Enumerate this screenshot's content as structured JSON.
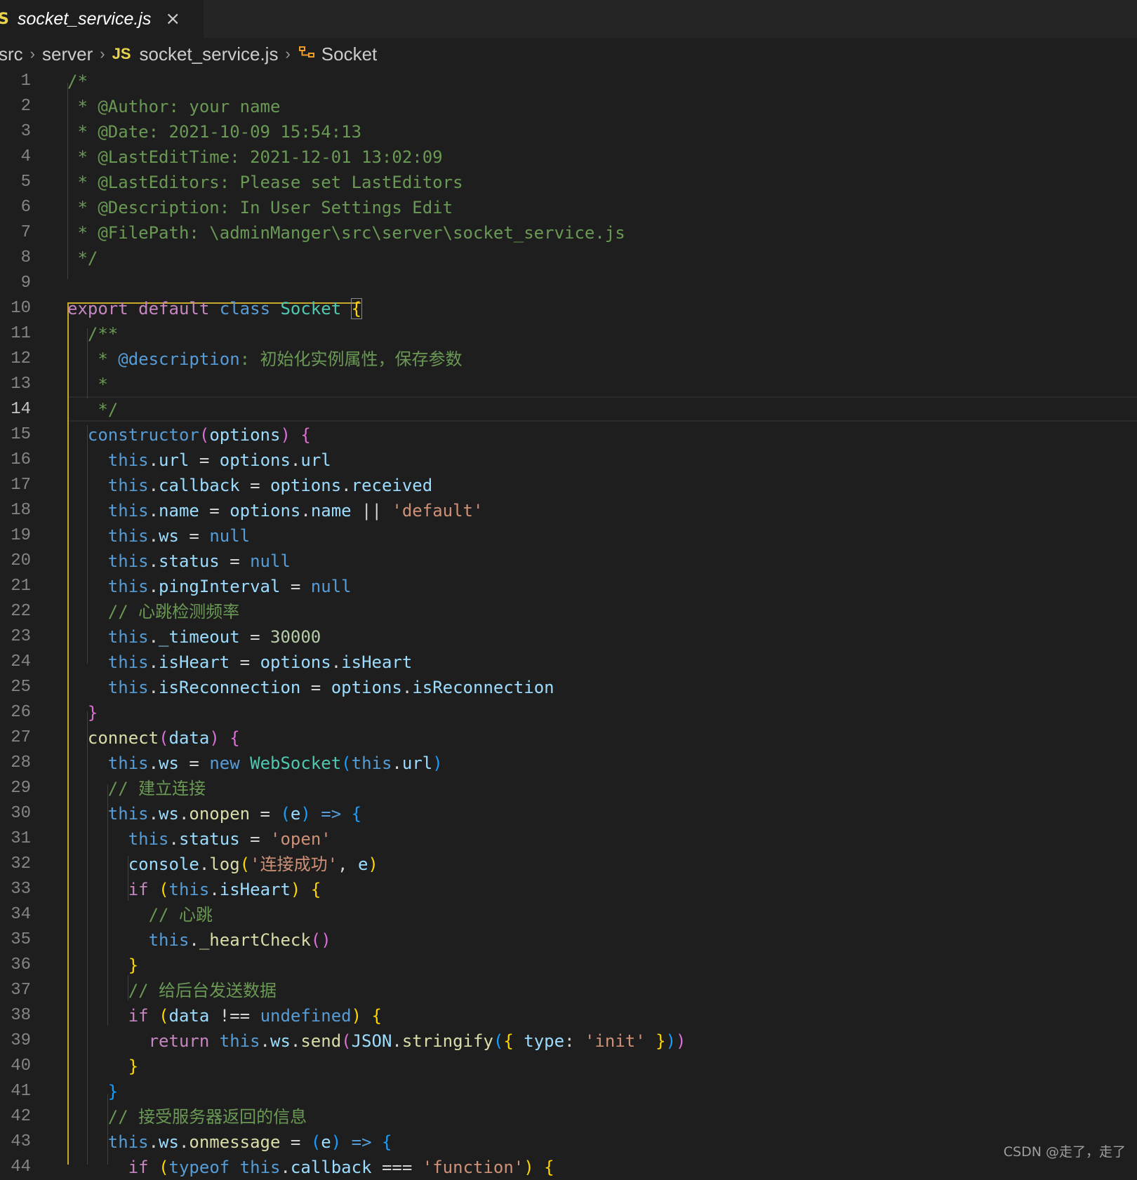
{
  "tab": {
    "language_icon": "S",
    "title": "socket_service.js",
    "close_icon": "×"
  },
  "breadcrumb": [
    {
      "label": "src"
    },
    {
      "label": "server"
    },
    {
      "label": "socket_service.js",
      "icon": "JS"
    },
    {
      "label": "Socket",
      "icon": "class-icon"
    }
  ],
  "breadcrumb_separator": "›",
  "editor": {
    "active_line": 14,
    "colors": {
      "comment": "#6a9955",
      "keyword_control": "#c586c0",
      "storage": "#569cd6",
      "class_name": "#4ec9b0",
      "function": "#dcdcaa",
      "variable": "#9cdcfe",
      "string": "#ce9178",
      "number": "#b5cea8",
      "bracket_gold": "#ffd700",
      "bracket_pink": "#da70d6",
      "bracket_blue": "#179fff",
      "indent_guide_active": "#c9a830"
    },
    "lines": [
      [
        [
          "/*",
          "#6a9955"
        ]
      ],
      [
        [
          " * @Author: your name",
          "#6a9955"
        ]
      ],
      [
        [
          " * @Date: 2021-10-09 15:54:13",
          "#6a9955"
        ]
      ],
      [
        [
          " * @LastEditTime: 2021-12-01 13:02:09",
          "#6a9955"
        ]
      ],
      [
        [
          " * @LastEditors: Please set LastEditors",
          "#6a9955"
        ]
      ],
      [
        [
          " * @Description: In User Settings Edit",
          "#6a9955"
        ]
      ],
      [
        [
          " * @FilePath: \\adminManger\\src\\server\\socket_service.js",
          "#6a9955"
        ]
      ],
      [
        [
          " */",
          "#6a9955"
        ]
      ],
      [],
      [
        [
          "export",
          "#c586c0"
        ],
        [
          " ",
          ""
        ],
        [
          "default",
          "#c586c0"
        ],
        [
          " ",
          ""
        ],
        [
          "class",
          "#569cd6"
        ],
        [
          " ",
          ""
        ],
        [
          "Socket",
          "#4ec9b0"
        ],
        [
          " ",
          ""
        ],
        [
          "{",
          "#ffd700"
        ]
      ],
      [
        [
          "  /**",
          "#6a9955"
        ]
      ],
      [
        [
          "   * ",
          "#6a9955"
        ],
        [
          "@description",
          "#569cd6"
        ],
        [
          ": 初始化实例属性，保存参数",
          "#6a9955"
        ]
      ],
      [
        [
          "   *",
          "#6a9955"
        ]
      ],
      [
        [
          "   */",
          "#6a9955"
        ]
      ],
      [
        [
          "  ",
          ""
        ],
        [
          "constructor",
          "#569cd6"
        ],
        [
          "(",
          "#da70d6"
        ],
        [
          "options",
          "#9cdcfe"
        ],
        [
          ")",
          "#da70d6"
        ],
        [
          " ",
          ""
        ],
        [
          "{",
          "#da70d6"
        ]
      ],
      [
        [
          "    ",
          ""
        ],
        [
          "this",
          "#569cd6"
        ],
        [
          ".",
          ""
        ],
        [
          "url",
          "#9cdcfe"
        ],
        [
          " = ",
          ""
        ],
        [
          "options",
          "#9cdcfe"
        ],
        [
          ".",
          ""
        ],
        [
          "url",
          "#9cdcfe"
        ]
      ],
      [
        [
          "    ",
          ""
        ],
        [
          "this",
          "#569cd6"
        ],
        [
          ".",
          ""
        ],
        [
          "callback",
          "#9cdcfe"
        ],
        [
          " = ",
          ""
        ],
        [
          "options",
          "#9cdcfe"
        ],
        [
          ".",
          ""
        ],
        [
          "received",
          "#9cdcfe"
        ]
      ],
      [
        [
          "    ",
          ""
        ],
        [
          "this",
          "#569cd6"
        ],
        [
          ".",
          ""
        ],
        [
          "name",
          "#9cdcfe"
        ],
        [
          " = ",
          ""
        ],
        [
          "options",
          "#9cdcfe"
        ],
        [
          ".",
          ""
        ],
        [
          "name",
          "#9cdcfe"
        ],
        [
          " || ",
          ""
        ],
        [
          "'default'",
          "#ce9178"
        ]
      ],
      [
        [
          "    ",
          ""
        ],
        [
          "this",
          "#569cd6"
        ],
        [
          ".",
          ""
        ],
        [
          "ws",
          "#9cdcfe"
        ],
        [
          " = ",
          ""
        ],
        [
          "null",
          "#569cd6"
        ]
      ],
      [
        [
          "    ",
          ""
        ],
        [
          "this",
          "#569cd6"
        ],
        [
          ".",
          ""
        ],
        [
          "status",
          "#9cdcfe"
        ],
        [
          " = ",
          ""
        ],
        [
          "null",
          "#569cd6"
        ]
      ],
      [
        [
          "    ",
          ""
        ],
        [
          "this",
          "#569cd6"
        ],
        [
          ".",
          ""
        ],
        [
          "pingInterval",
          "#9cdcfe"
        ],
        [
          " = ",
          ""
        ],
        [
          "null",
          "#569cd6"
        ]
      ],
      [
        [
          "    ",
          ""
        ],
        [
          "// 心跳检测频率",
          "#6a9955"
        ]
      ],
      [
        [
          "    ",
          ""
        ],
        [
          "this",
          "#569cd6"
        ],
        [
          ".",
          ""
        ],
        [
          "_timeout",
          "#9cdcfe"
        ],
        [
          " = ",
          ""
        ],
        [
          "30000",
          "#b5cea8"
        ]
      ],
      [
        [
          "    ",
          ""
        ],
        [
          "this",
          "#569cd6"
        ],
        [
          ".",
          ""
        ],
        [
          "isHeart",
          "#9cdcfe"
        ],
        [
          " = ",
          ""
        ],
        [
          "options",
          "#9cdcfe"
        ],
        [
          ".",
          ""
        ],
        [
          "isHeart",
          "#9cdcfe"
        ]
      ],
      [
        [
          "    ",
          ""
        ],
        [
          "this",
          "#569cd6"
        ],
        [
          ".",
          ""
        ],
        [
          "isReconnection",
          "#9cdcfe"
        ],
        [
          " = ",
          ""
        ],
        [
          "options",
          "#9cdcfe"
        ],
        [
          ".",
          ""
        ],
        [
          "isReconnection",
          "#9cdcfe"
        ]
      ],
      [
        [
          "  ",
          ""
        ],
        [
          "}",
          "#da70d6"
        ]
      ],
      [
        [
          "  ",
          ""
        ],
        [
          "connect",
          "#dcdcaa"
        ],
        [
          "(",
          "#da70d6"
        ],
        [
          "data",
          "#9cdcfe"
        ],
        [
          ")",
          "#da70d6"
        ],
        [
          " ",
          ""
        ],
        [
          "{",
          "#da70d6"
        ]
      ],
      [
        [
          "    ",
          ""
        ],
        [
          "this",
          "#569cd6"
        ],
        [
          ".",
          ""
        ],
        [
          "ws",
          "#9cdcfe"
        ],
        [
          " = ",
          ""
        ],
        [
          "new",
          "#569cd6"
        ],
        [
          " ",
          ""
        ],
        [
          "WebSocket",
          "#4ec9b0"
        ],
        [
          "(",
          "#179fff"
        ],
        [
          "this",
          "#569cd6"
        ],
        [
          ".",
          ""
        ],
        [
          "url",
          "#9cdcfe"
        ],
        [
          ")",
          "#179fff"
        ]
      ],
      [
        [
          "    ",
          ""
        ],
        [
          "// 建立连接",
          "#6a9955"
        ]
      ],
      [
        [
          "    ",
          ""
        ],
        [
          "this",
          "#569cd6"
        ],
        [
          ".",
          ""
        ],
        [
          "ws",
          "#9cdcfe"
        ],
        [
          ".",
          ""
        ],
        [
          "onopen",
          "#dcdcaa"
        ],
        [
          " = ",
          ""
        ],
        [
          "(",
          "#179fff"
        ],
        [
          "e",
          "#9cdcfe"
        ],
        [
          ")",
          "#179fff"
        ],
        [
          " ",
          ""
        ],
        [
          "=>",
          "#569cd6"
        ],
        [
          " ",
          ""
        ],
        [
          "{",
          "#179fff"
        ]
      ],
      [
        [
          "      ",
          ""
        ],
        [
          "this",
          "#569cd6"
        ],
        [
          ".",
          ""
        ],
        [
          "status",
          "#9cdcfe"
        ],
        [
          " = ",
          ""
        ],
        [
          "'open'",
          "#ce9178"
        ]
      ],
      [
        [
          "      ",
          ""
        ],
        [
          "console",
          "#9cdcfe"
        ],
        [
          ".",
          ""
        ],
        [
          "log",
          "#dcdcaa"
        ],
        [
          "(",
          "#ffd700"
        ],
        [
          "'连接成功'",
          "#ce9178"
        ],
        [
          ", ",
          ""
        ],
        [
          "e",
          "#9cdcfe"
        ],
        [
          ")",
          "#ffd700"
        ]
      ],
      [
        [
          "      ",
          ""
        ],
        [
          "if",
          "#c586c0"
        ],
        [
          " ",
          ""
        ],
        [
          "(",
          "#ffd700"
        ],
        [
          "this",
          "#569cd6"
        ],
        [
          ".",
          ""
        ],
        [
          "isHeart",
          "#9cdcfe"
        ],
        [
          ")",
          "#ffd700"
        ],
        [
          " ",
          ""
        ],
        [
          "{",
          "#ffd700"
        ]
      ],
      [
        [
          "        ",
          ""
        ],
        [
          "// 心跳",
          "#6a9955"
        ]
      ],
      [
        [
          "        ",
          ""
        ],
        [
          "this",
          "#569cd6"
        ],
        [
          ".",
          ""
        ],
        [
          "_heartCheck",
          "#dcdcaa"
        ],
        [
          "()",
          "#da70d6"
        ]
      ],
      [
        [
          "      ",
          ""
        ],
        [
          "}",
          "#ffd700"
        ]
      ],
      [
        [
          "      ",
          ""
        ],
        [
          "// 给后台发送数据",
          "#6a9955"
        ]
      ],
      [
        [
          "      ",
          ""
        ],
        [
          "if",
          "#c586c0"
        ],
        [
          " ",
          ""
        ],
        [
          "(",
          "#ffd700"
        ],
        [
          "data",
          "#9cdcfe"
        ],
        [
          " !== ",
          ""
        ],
        [
          "undefined",
          "#569cd6"
        ],
        [
          ")",
          "#ffd700"
        ],
        [
          " ",
          ""
        ],
        [
          "{",
          "#ffd700"
        ]
      ],
      [
        [
          "        ",
          ""
        ],
        [
          "return",
          "#c586c0"
        ],
        [
          " ",
          ""
        ],
        [
          "this",
          "#569cd6"
        ],
        [
          ".",
          ""
        ],
        [
          "ws",
          "#9cdcfe"
        ],
        [
          ".",
          ""
        ],
        [
          "send",
          "#dcdcaa"
        ],
        [
          "(",
          "#da70d6"
        ],
        [
          "JSON",
          "#9cdcfe"
        ],
        [
          ".",
          ""
        ],
        [
          "stringify",
          "#dcdcaa"
        ],
        [
          "(",
          "#179fff"
        ],
        [
          "{",
          "#ffd700"
        ],
        [
          " ",
          ""
        ],
        [
          "type",
          "#9cdcfe"
        ],
        [
          ": ",
          ""
        ],
        [
          "'init'",
          "#ce9178"
        ],
        [
          " ",
          ""
        ],
        [
          "}",
          "#ffd700"
        ],
        [
          ")",
          "#179fff"
        ],
        [
          ")",
          "#da70d6"
        ]
      ],
      [
        [
          "      ",
          ""
        ],
        [
          "}",
          "#ffd700"
        ]
      ],
      [
        [
          "    ",
          ""
        ],
        [
          "}",
          "#179fff"
        ]
      ],
      [
        [
          "    ",
          ""
        ],
        [
          "// 接受服务器返回的信息",
          "#6a9955"
        ]
      ],
      [
        [
          "    ",
          ""
        ],
        [
          "this",
          "#569cd6"
        ],
        [
          ".",
          ""
        ],
        [
          "ws",
          "#9cdcfe"
        ],
        [
          ".",
          ""
        ],
        [
          "onmessage",
          "#dcdcaa"
        ],
        [
          " = ",
          ""
        ],
        [
          "(",
          "#179fff"
        ],
        [
          "e",
          "#9cdcfe"
        ],
        [
          ")",
          "#179fff"
        ],
        [
          " ",
          ""
        ],
        [
          "=>",
          "#569cd6"
        ],
        [
          " ",
          ""
        ],
        [
          "{",
          "#179fff"
        ]
      ],
      [
        [
          "      ",
          ""
        ],
        [
          "if",
          "#c586c0"
        ],
        [
          " ",
          ""
        ],
        [
          "(",
          "#ffd700"
        ],
        [
          "typeof",
          "#569cd6"
        ],
        [
          " ",
          ""
        ],
        [
          "this",
          "#569cd6"
        ],
        [
          ".",
          ""
        ],
        [
          "callback",
          "#9cdcfe"
        ],
        [
          " === ",
          ""
        ],
        [
          "'function'",
          "#ce9178"
        ],
        [
          ")",
          "#ffd700"
        ],
        [
          " ",
          ""
        ],
        [
          "{",
          "#ffd700"
        ]
      ]
    ]
  },
  "watermark": "CSDN @走了，走了"
}
